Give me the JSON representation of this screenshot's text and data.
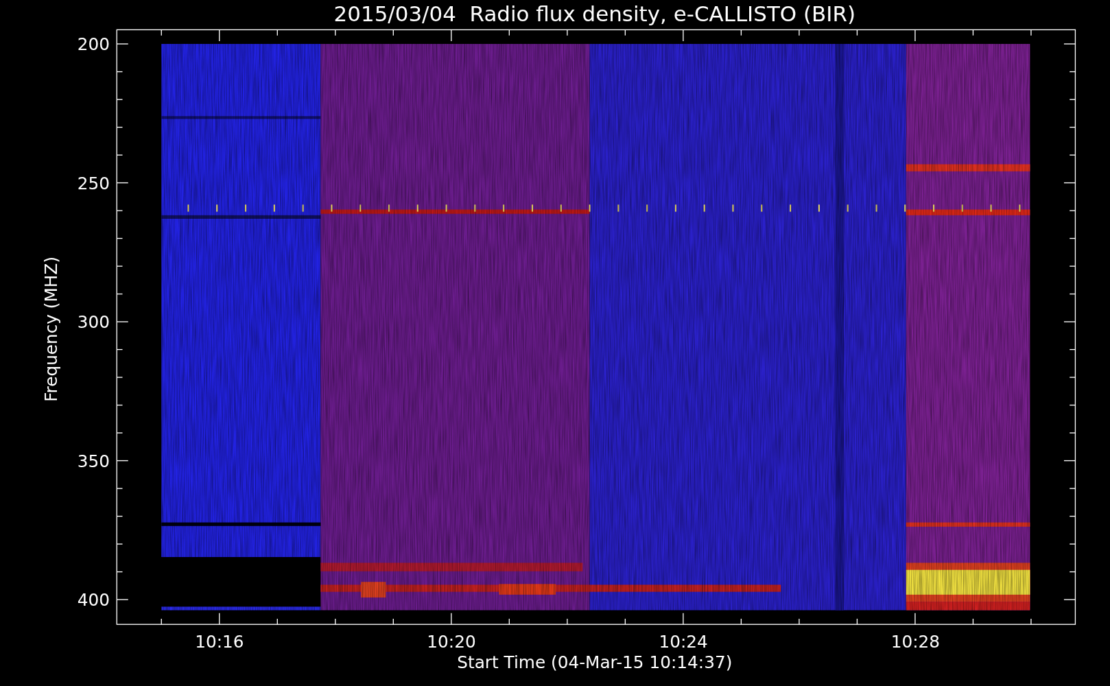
{
  "plot": {
    "title": "2015/03/04  Radio flux density, e-CALLISTO (BIR)",
    "y_axis": {
      "label": "Frequency (MHZ)",
      "ticks": [
        "200",
        "250",
        "300",
        "350",
        "400"
      ]
    },
    "x_axis": {
      "label": "Start Time (04-Mar-15 10:14:37)",
      "ticks": [
        "10:16",
        "10:20",
        "10:24",
        "10:28"
      ]
    }
  }
}
